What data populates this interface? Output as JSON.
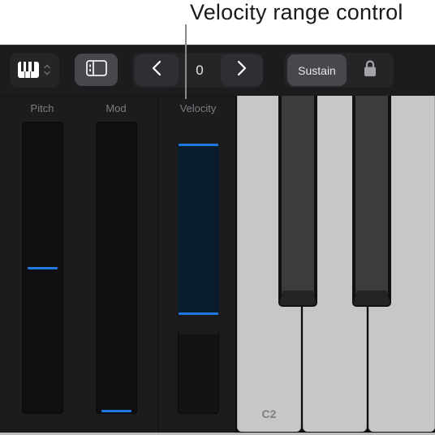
{
  "callout": {
    "label": "Velocity range control"
  },
  "toolbar": {
    "keyboard_menu": {
      "icon": "piano-keys-icon",
      "chevron": "chevron-up-down-icon"
    },
    "layout_button": {
      "icon": "sidebar-layout-icon"
    },
    "octave": {
      "prev_icon": "chevron-left-icon",
      "value": "0",
      "next_icon": "chevron-right-icon"
    },
    "sustain_label": "Sustain",
    "lock_icon": "lock-icon"
  },
  "controls": {
    "pitch": {
      "label": "Pitch",
      "value_fraction": 0.5
    },
    "mod": {
      "label": "Mod",
      "value_fraction": 0.0
    },
    "velocity": {
      "label": "Velocity",
      "range_high_fraction": 0.93,
      "range_low_fraction": 0.34
    }
  },
  "keyboard": {
    "white_keys": [
      {
        "note": "C2",
        "label": "C2"
      },
      {
        "note": "D2",
        "label": ""
      },
      {
        "note": "E2",
        "label": ""
      }
    ],
    "black_keys": [
      {
        "note": "C#2"
      },
      {
        "note": "D#2"
      }
    ]
  },
  "colors": {
    "accent": "#1f7ae0",
    "background": "#1c1c1e",
    "white_key": "#c6c7c8",
    "black_key": "#3b3c3e"
  }
}
